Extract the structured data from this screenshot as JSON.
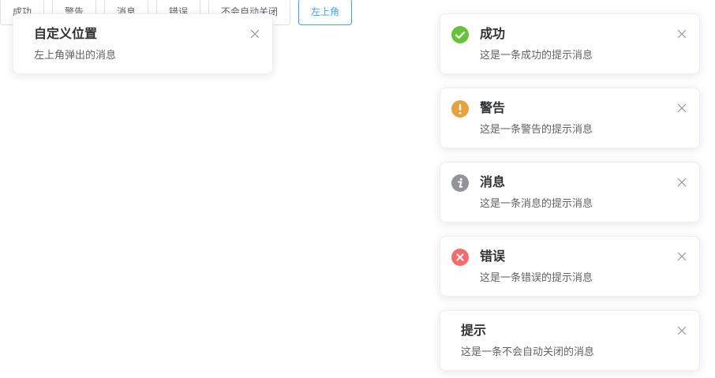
{
  "buttons": {
    "success": "成功",
    "warning": "警告",
    "info": "消息",
    "error": "错误",
    "no_auto_close": "不会自动关闭",
    "top_left": "左上角"
  },
  "custom_notification": {
    "title": "自定义位置",
    "message": "左上角弹出的消息"
  },
  "notifications": [
    {
      "title": "成功",
      "message": "这是一条成功的提示消息",
      "icon": "check-circle-icon",
      "color": "#67c23a"
    },
    {
      "title": "警告",
      "message": "这是一条警告的提示消息",
      "icon": "warning-circle-icon",
      "color": "#e6a23c"
    },
    {
      "title": "消息",
      "message": "这是一条消息的提示消息",
      "icon": "info-circle-icon",
      "color": "#909399"
    },
    {
      "title": "错误",
      "message": "这是一条错误的提示消息",
      "icon": "error-circle-icon",
      "color": "#f56c6c"
    },
    {
      "title": "提示",
      "message": "这是一条不会自动关闭的消息",
      "icon": "",
      "color": ""
    }
  ],
  "theme": {
    "primary": "#409eff",
    "border": "#dcdfe6",
    "text_primary": "#303133",
    "text_regular": "#606266",
    "close_icon": "#909399"
  }
}
